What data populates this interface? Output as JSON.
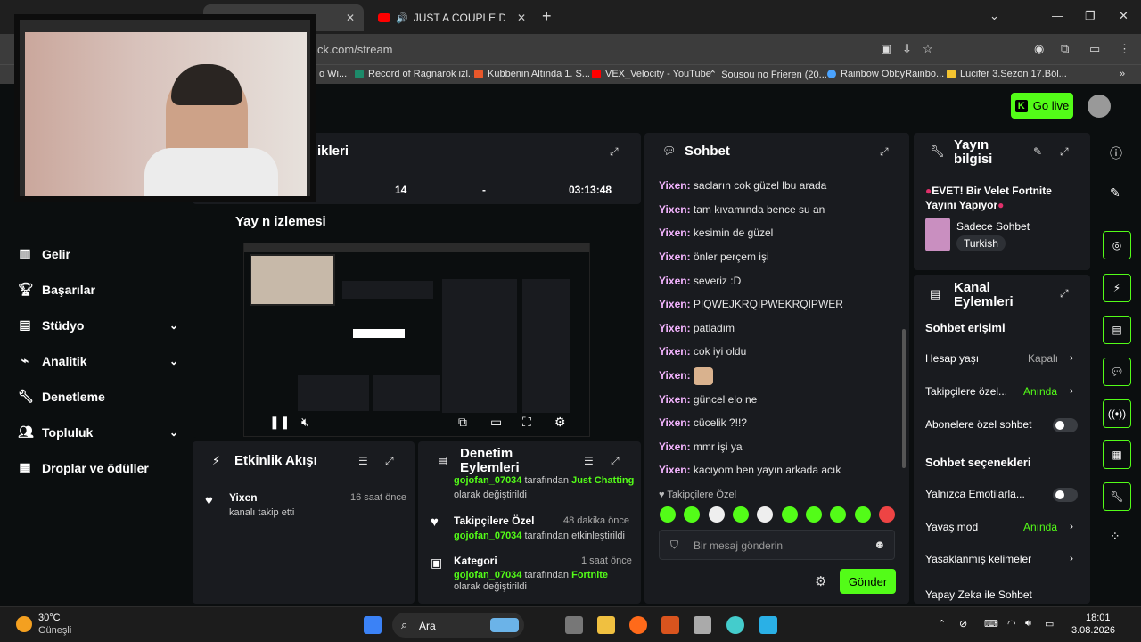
{
  "browser": {
    "tabs": [
      {
        "label": "",
        "active": true
      },
      {
        "label": "JUST A COUPLE DAYS IN TÜ",
        "active": false
      }
    ],
    "url": "ck.com/stream",
    "bookmarks": [
      "o Wi...",
      "Record of Ragnarok izl...",
      "Kubbenin Altında 1. S...",
      "VEX_Velocity - YouTube",
      "Sousou no Frieren (20...",
      "Rainbow ObbyRainbo...",
      "Lucifer 3.Sezon 17.Böl..."
    ]
  },
  "header": {
    "go_live": "Go live"
  },
  "nav": [
    {
      "label": "Gelir",
      "icon": "chart-icon",
      "chevron": false
    },
    {
      "label": "Başarılar",
      "icon": "trophy-icon",
      "chevron": false
    },
    {
      "label": "Stüdyo",
      "icon": "studio-icon",
      "chevron": true
    },
    {
      "label": "Analitik",
      "icon": "analytics-icon",
      "chevron": true
    },
    {
      "label": "Denetleme",
      "icon": "wrench-icon",
      "chevron": false
    },
    {
      "label": "Topluluk",
      "icon": "community-icon",
      "chevron": true
    },
    {
      "label": "Droplar ve ödüller",
      "icon": "drops-icon",
      "chevron": false
    }
  ],
  "stats": {
    "title_fragment": "ikleri",
    "viewers": "14",
    "followers": "-",
    "duration": "03:13:48",
    "preview_title_fragment": "Yay   n izlemesi"
  },
  "activity": {
    "title": "Etkinlik Akışı",
    "items": [
      {
        "name": "Yixen",
        "desc": "kanalı takip etti",
        "time": "16 saat önce"
      }
    ]
  },
  "moderation": {
    "title": "Denetim Eylemleri",
    "items": [
      {
        "title": "",
        "user": "gojofan_07034",
        "mid": "tarafından",
        "target": "Just Chatting",
        "tail": "olarak değiştirildi",
        "time": ""
      },
      {
        "title": "Takipçilere Özel",
        "user": "gojofan_07034",
        "mid": "tarafından etkinleştirildi",
        "target": "",
        "tail": "",
        "time": "48 dakika önce"
      },
      {
        "title": "Kategori",
        "user": "gojofan_07034",
        "mid": "tarafından",
        "target": "Fortnite",
        "tail": "olarak değiştirildi",
        "time": "1 saat önce"
      }
    ]
  },
  "chat": {
    "title": "Sohbet",
    "messages": [
      {
        "user": "Yixen:",
        "text": "sacların cok güzel lbu arada"
      },
      {
        "user": "Yixen:",
        "text": "tam kıvamında bence su an"
      },
      {
        "user": "Yixen:",
        "text": "kesimin de güzel"
      },
      {
        "user": "Yixen:",
        "text": "önler perçem işi"
      },
      {
        "user": "Yixen:",
        "text": "severiz :D"
      },
      {
        "user": "Yixen:",
        "text": "PIQWEJKRQIPWEKRQIPWER"
      },
      {
        "user": "Yixen:",
        "text": "patladım"
      },
      {
        "user": "Yixen:",
        "text": "cok iyi oldu"
      },
      {
        "user": "Yixen:",
        "text": ""
      },
      {
        "user": "Yixen:",
        "text": "güncel elo ne"
      },
      {
        "user": "Yixen:",
        "text": "cücelik ?!!?"
      },
      {
        "user": "Yixen:",
        "text": "mmr işi ya"
      },
      {
        "user": "Yixen:",
        "text": "kacıyom ben yayın arkada acık"
      }
    ],
    "followers_only": "Takipçilere Özel",
    "placeholder": "Bir mesaj gönderin",
    "send": "Gönder"
  },
  "stream_info": {
    "title": "Yayın bilgisi",
    "stream_title": "EVET! Bir Velet Fortnite Yayını Yapıyor",
    "category": "Sadece Sohbet",
    "language": "Turkish"
  },
  "channel_actions": {
    "title": "Kanal Eylemleri",
    "chat_access": "Sohbet erişimi",
    "settings": [
      {
        "label": "Hesap yaşı",
        "value": "Kapalı",
        "type": "link"
      },
      {
        "label": "Takipçilere özel...",
        "value": "Anında",
        "type": "link"
      },
      {
        "label": "Abonelere özel sohbet",
        "value": "",
        "type": "toggle"
      }
    ],
    "chat_options": "Sohbet seçenekleri",
    "options": [
      {
        "label": "Yalnızca Emotilarla...",
        "value": "",
        "type": "toggle"
      },
      {
        "label": "Yavaş mod",
        "value": "Anında",
        "type": "link"
      },
      {
        "label": "Yasaklanmış kelimeler",
        "value": "",
        "type": "link"
      },
      {
        "label": "Yapay Zeka ile Sohbet",
        "value": "",
        "type": "link"
      }
    ]
  },
  "taskbar": {
    "weather_temp": "30°C",
    "weather_desc": "Güneşli",
    "search": "Ara",
    "time": "18:01",
    "date": "3.08.2026"
  },
  "colors": {
    "accent": "#53fc18",
    "panel": "#191b1f",
    "background": "#0b0e0f",
    "username": "#f4b4ff"
  }
}
